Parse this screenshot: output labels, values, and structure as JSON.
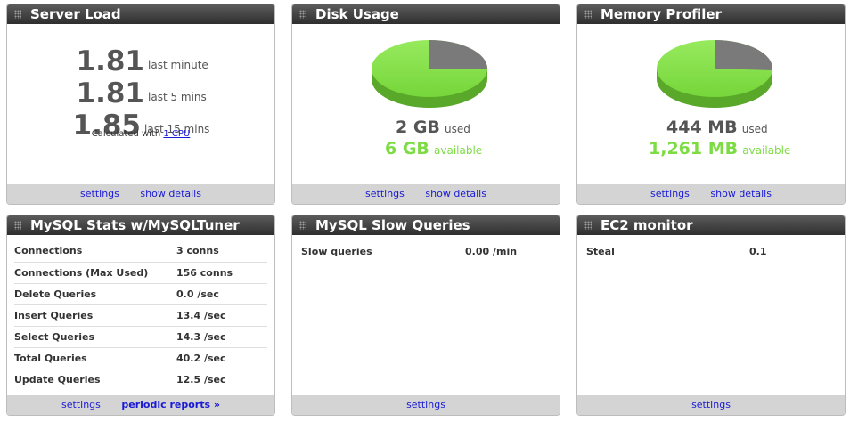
{
  "server_load": {
    "title": "Server Load",
    "rows": [
      {
        "value": "1.81",
        "label": "last minute"
      },
      {
        "value": "1.81",
        "label": "last 5 mins"
      },
      {
        "value": "1.85",
        "label": "last 15 mins"
      }
    ],
    "calc_prefix": "Calculated with",
    "calc_link": "1 CPU",
    "footer": [
      "settings",
      "show details"
    ]
  },
  "disk_usage": {
    "title": "Disk Usage",
    "used_value": "2 GB",
    "used_label": "used",
    "avail_value": "6 GB",
    "avail_label": "available",
    "used_fraction": 0.25,
    "footer": [
      "settings",
      "show details"
    ]
  },
  "memory_profiler": {
    "title": "Memory Profiler",
    "used_value": "444 MB",
    "used_label": "used",
    "avail_value": "1,261 MB",
    "avail_label": "available",
    "used_fraction": 0.26,
    "footer": [
      "settings",
      "show details"
    ]
  },
  "mysql_stats": {
    "title": "MySQL Stats w/MySQLTuner",
    "rows": [
      {
        "name": "Connections",
        "value": "3 conns"
      },
      {
        "name": "Connections (Max Used)",
        "value": "156 conns"
      },
      {
        "name": "Delete Queries",
        "value": "0.0 /sec"
      },
      {
        "name": "Insert Queries",
        "value": "13.4 /sec"
      },
      {
        "name": "Select Queries",
        "value": "14.3 /sec"
      },
      {
        "name": "Total Queries",
        "value": "40.2 /sec"
      },
      {
        "name": "Update Queries",
        "value": "12.5 /sec"
      }
    ],
    "footer": [
      "settings",
      "periodic reports »"
    ]
  },
  "mysql_slow": {
    "title": "MySQL Slow Queries",
    "label": "Slow queries",
    "value": "0.00 /min",
    "footer": [
      "settings"
    ]
  },
  "ec2": {
    "title": "EC2 monitor",
    "label": "Steal",
    "value": "0.1",
    "footer": [
      "settings"
    ]
  },
  "colors": {
    "header_bg": "#3f3f3f",
    "footer_bg": "#d4d4d4",
    "link": "#1a1ad6",
    "pie_green": "#7ddc44",
    "pie_gray": "#7a7a7a"
  }
}
